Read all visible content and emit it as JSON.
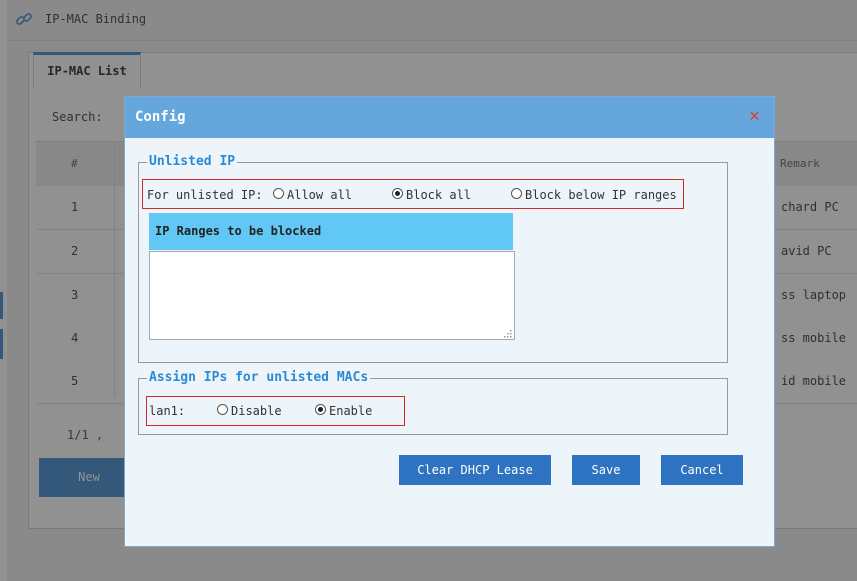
{
  "header": {
    "title": "IP-MAC Binding",
    "icon": "link-icon"
  },
  "tabs": [
    {
      "label": "IP-MAC List"
    }
  ],
  "search": {
    "label": "Search:"
  },
  "table": {
    "columns": {
      "index": "#",
      "remark": "Remark"
    },
    "rows": [
      {
        "num": "1",
        "remark": "chard PC"
      },
      {
        "num": "2",
        "remark": "avid PC"
      },
      {
        "num": "3",
        "remark": "ss laptop"
      },
      {
        "num": "4",
        "remark": "ss mobile"
      },
      {
        "num": "5",
        "remark": "id mobile"
      }
    ]
  },
  "pager": {
    "text": "1/1 ,"
  },
  "toolbar": {
    "new_label": "New"
  },
  "dialog": {
    "title": "Config",
    "close_icon": "close-icon",
    "unlisted_ip": {
      "legend": "Unlisted IP",
      "label": "For unlisted IP:",
      "options": [
        "Allow all",
        "Block all",
        "Block below IP ranges"
      ],
      "selected": "Block all",
      "ranges_header": "IP Ranges to be blocked",
      "ranges_value": ""
    },
    "assign": {
      "legend": "Assign IPs for unlisted MACs",
      "interface": "lan1:",
      "options": [
        "Disable",
        "Enable"
      ],
      "selected": "Enable"
    },
    "buttons": {
      "clear": "Clear DHCP Lease",
      "save": "Save",
      "cancel": "Cancel"
    }
  },
  "colors": {
    "dialog_header": "#65a6dc",
    "legend_text": "#2a8ad6",
    "ranges_header": "#61c7f4",
    "button": "#2e72c2",
    "highlight_box": "#d32a2a",
    "close": "#e0402e"
  }
}
